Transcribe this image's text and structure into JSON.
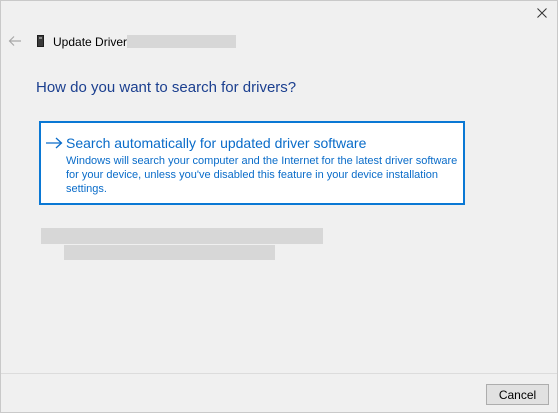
{
  "window": {
    "title": "Update Drivers"
  },
  "heading": "How do you want to search for drivers?",
  "option": {
    "title": "Search automatically for updated driver software",
    "description": "Windows will search your computer and the Internet for the latest driver software for your device, unless you've disabled this feature in your device installation settings."
  },
  "footer": {
    "cancel_label": "Cancel"
  },
  "icons": {
    "close": "close-icon",
    "back": "back-arrow-icon",
    "device": "device-icon",
    "option_arrow": "right-arrow-icon"
  },
  "colors": {
    "heading": "#1b3f8f",
    "accent": "#0a78d4",
    "link_text": "#0a6cc9",
    "background": "#f0f0f0",
    "redaction": "#d7d7d7"
  }
}
